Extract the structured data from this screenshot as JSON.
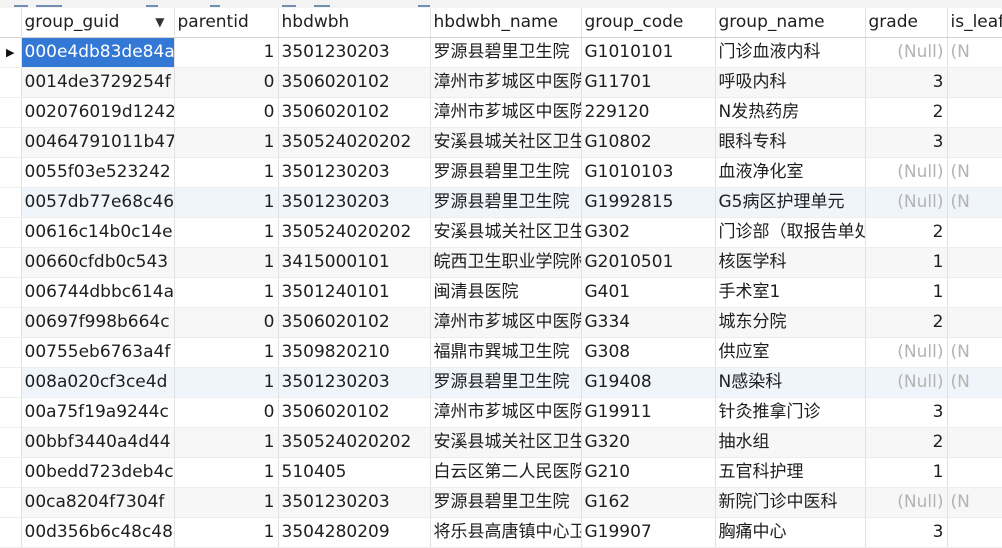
{
  "toolbar": {
    "icon": "toolbar-icons"
  },
  "columns": [
    "group_guid",
    "parentid",
    "hbdwbh",
    "hbdwbh_name",
    "group_code",
    "group_name",
    "grade",
    "is_leaf"
  ],
  "sorted_column_icon": "dropdown-triangle",
  "current_row_marker": "▶",
  "rows": [
    [
      "000e4db83de84a",
      "1",
      "3501230203",
      "罗源县碧里卫生院",
      "G1010101",
      "门诊血液内科",
      "(Null)",
      "(N"
    ],
    [
      "0014de3729254f",
      "0",
      "3506020102",
      "漳州市芗城区中医院",
      "G11701",
      "呼吸内科",
      "3",
      ""
    ],
    [
      "002076019d1242",
      "0",
      "3506020102",
      "漳州市芗城区中医院",
      "229120",
      "N发热药房",
      "2",
      ""
    ],
    [
      "00464791011b47",
      "1",
      "350524020202",
      "安溪县城关社区卫生",
      "G10802",
      "眼科专科",
      "3",
      ""
    ],
    [
      "0055f03e523242",
      "1",
      "3501230203",
      "罗源县碧里卫生院",
      "G1010103",
      "血液净化室",
      "(Null)",
      "(N"
    ],
    [
      "0057db77e68c46",
      "1",
      "3501230203",
      "罗源县碧里卫生院",
      "G1992815",
      "G5病区护理单元",
      "(Null)",
      "(N"
    ],
    [
      "00616c14b0c14e",
      "1",
      "350524020202",
      "安溪县城关社区卫生",
      "G302",
      "门诊部（取报告单处",
      "2",
      ""
    ],
    [
      "00660cfdb0c543",
      "1",
      "3415000101",
      "皖西卫生职业学院附",
      "G2010501",
      "核医学科",
      "1",
      ""
    ],
    [
      "006744dbbc614a",
      "1",
      "3501240101",
      "闽清县医院",
      "G401",
      "手术室1",
      "1",
      ""
    ],
    [
      "00697f998b664c",
      "0",
      "3506020102",
      "漳州市芗城区中医院",
      "G334",
      "城东分院",
      "2",
      ""
    ],
    [
      "00755eb6763a4f",
      "1",
      "3509820210",
      "福鼎市巽城卫生院",
      "G308",
      "供应室",
      "(Null)",
      "(N"
    ],
    [
      "008a020cf3ce4d",
      "1",
      "3501230203",
      "罗源县碧里卫生院",
      "G19408",
      "N感染科",
      "(Null)",
      "(N"
    ],
    [
      "00a75f19a9244c",
      "0",
      "3506020102",
      "漳州市芗城区中医院",
      "G19911",
      "针灸推拿门诊",
      "3",
      ""
    ],
    [
      "00bbf3440a4d44",
      "1",
      "350524020202",
      "安溪县城关社区卫生",
      "G320",
      "抽水组",
      "2",
      ""
    ],
    [
      "00bedd723deb4c",
      "1",
      "510405",
      "白云区第二人民医院",
      "G210",
      "五官科护理",
      "1",
      ""
    ],
    [
      "00ca8204f7304f",
      "1",
      "3501230203",
      "罗源县碧里卫生院",
      "G162",
      "新院门诊中医科",
      "(Null)",
      "(N"
    ],
    [
      "00d356b6c48c48",
      "1",
      "3504280209",
      "将乐县高唐镇中心卫",
      "G19907",
      "胸痛中心",
      "3",
      ""
    ]
  ]
}
